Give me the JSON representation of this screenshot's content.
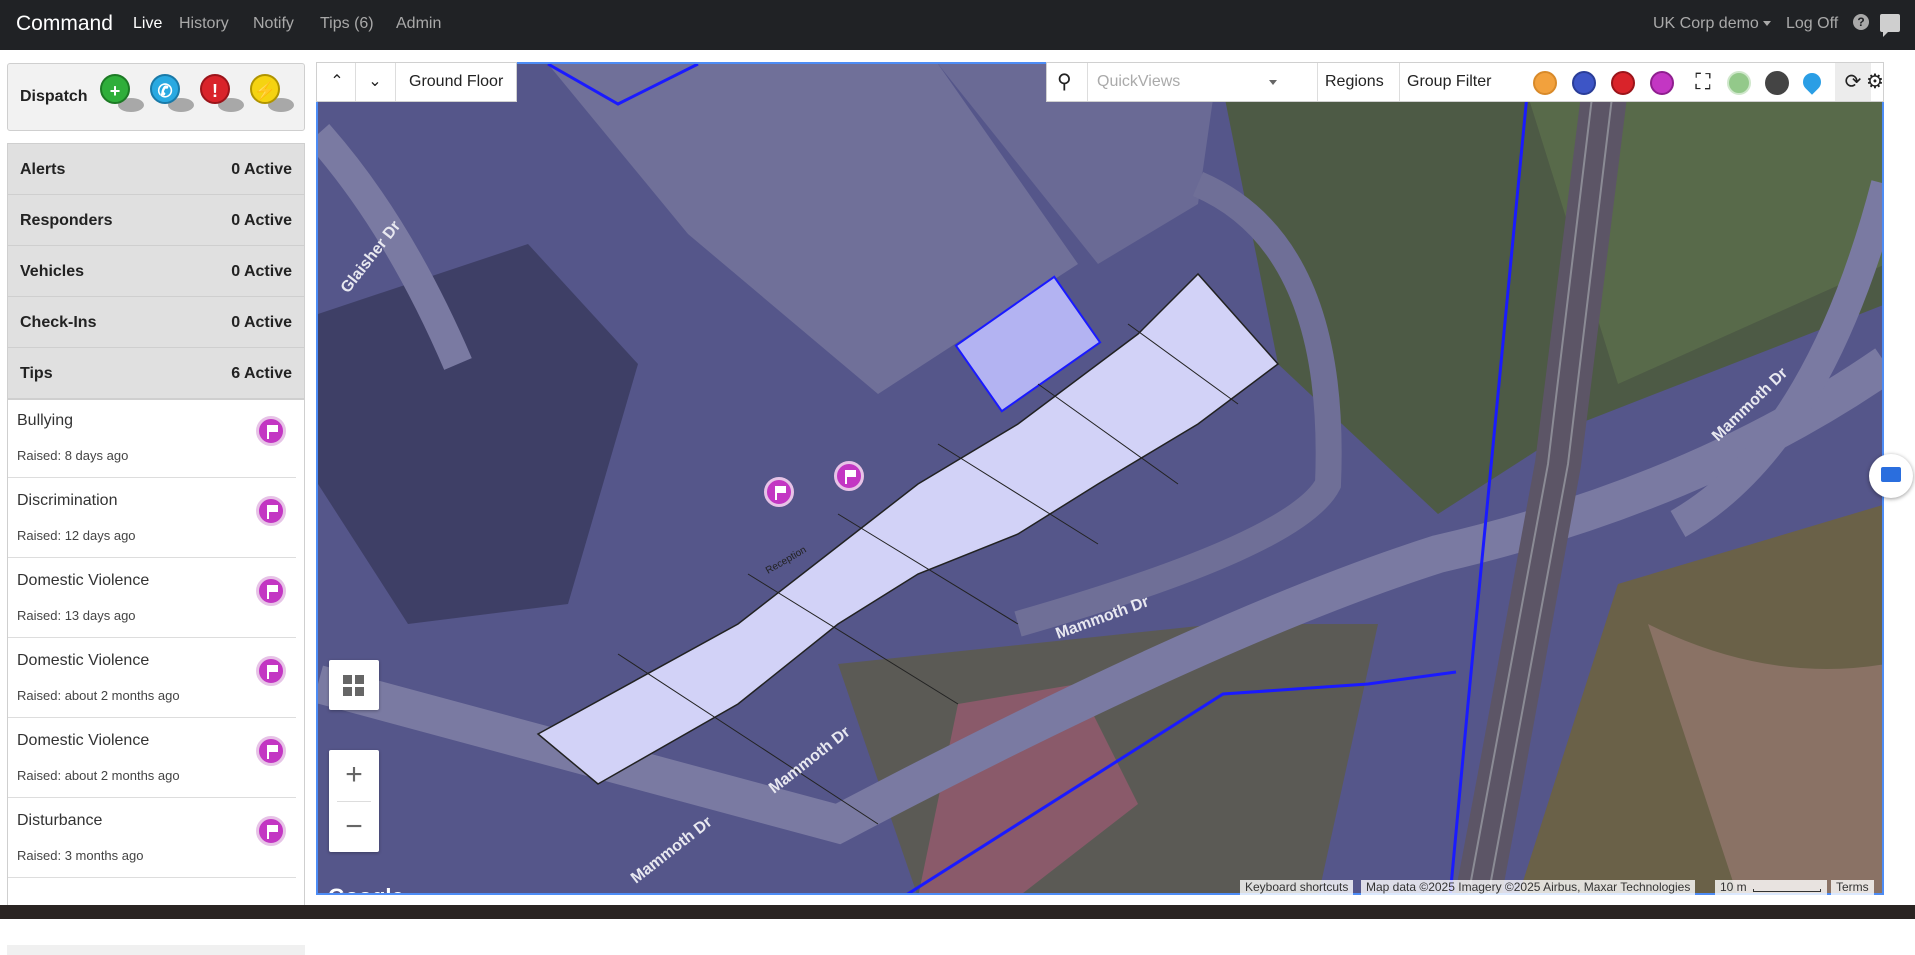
{
  "nav": {
    "brand": "Command",
    "links": [
      {
        "label": "Live",
        "active": true
      },
      {
        "label": "History",
        "active": false
      },
      {
        "label": "Notify",
        "active": false
      },
      {
        "label": "Tips (6)",
        "active": false
      },
      {
        "label": "Admin",
        "active": false
      }
    ],
    "org": "UK Corp demo",
    "logoff": "Log Off",
    "help": "?"
  },
  "dispatch": {
    "label": "Dispatch",
    "icons": [
      {
        "name": "medical-dispatch-icon",
        "color": "#2fae3a",
        "glyph": "+"
      },
      {
        "name": "phone-dispatch-icon",
        "color": "#29a9e1",
        "glyph": "✆"
      },
      {
        "name": "alert-dispatch-icon",
        "color": "#d9232a",
        "glyph": "!"
      },
      {
        "name": "power-dispatch-icon",
        "color": "#f5d311",
        "glyph": "⚡"
      }
    ]
  },
  "summary": [
    {
      "label": "Alerts",
      "value": "0 Active"
    },
    {
      "label": "Responders",
      "value": "0 Active"
    },
    {
      "label": "Vehicles",
      "value": "0 Active"
    },
    {
      "label": "Check-Ins",
      "value": "0 Active"
    },
    {
      "label": "Tips",
      "value": "6 Active"
    }
  ],
  "tips": [
    {
      "title": "Bullying",
      "raised": "Raised: 8 days ago"
    },
    {
      "title": "Discrimination",
      "raised": "Raised: 12 days ago"
    },
    {
      "title": "Domestic Violence",
      "raised": "Raised: 13 days ago"
    },
    {
      "title": "Domestic Violence",
      "raised": "Raised: about 2 months ago"
    },
    {
      "title": "Domestic Violence",
      "raised": "Raised: about 2 months ago"
    },
    {
      "title": "Disturbance",
      "raised": "Raised: 3 months ago"
    }
  ],
  "map": {
    "floor": "Ground Floor",
    "quickviews_placeholder": "QuickViews",
    "regions": "Regions",
    "group_filter": "Group Filter",
    "google": "Google",
    "attribution": {
      "shortcuts": "Keyboard shortcuts",
      "data": "Map data ©2025 Imagery ©2025 Airbus, Maxar Technologies",
      "scale": "10 m",
      "terms": "Terms"
    },
    "street_labels": [
      "Glaisher Dr",
      "Mammoth Dr",
      "Mammoth Dr",
      "Mammoth Dr",
      "Mammoth Dr"
    ],
    "building_label": "Reception"
  },
  "colors": {
    "nav_bg": "#202225",
    "map_border": "#4d8cf5",
    "tip_flag": "#c336c3",
    "building_fill": "#d2d2f7",
    "region_line": "#1a1aff"
  }
}
